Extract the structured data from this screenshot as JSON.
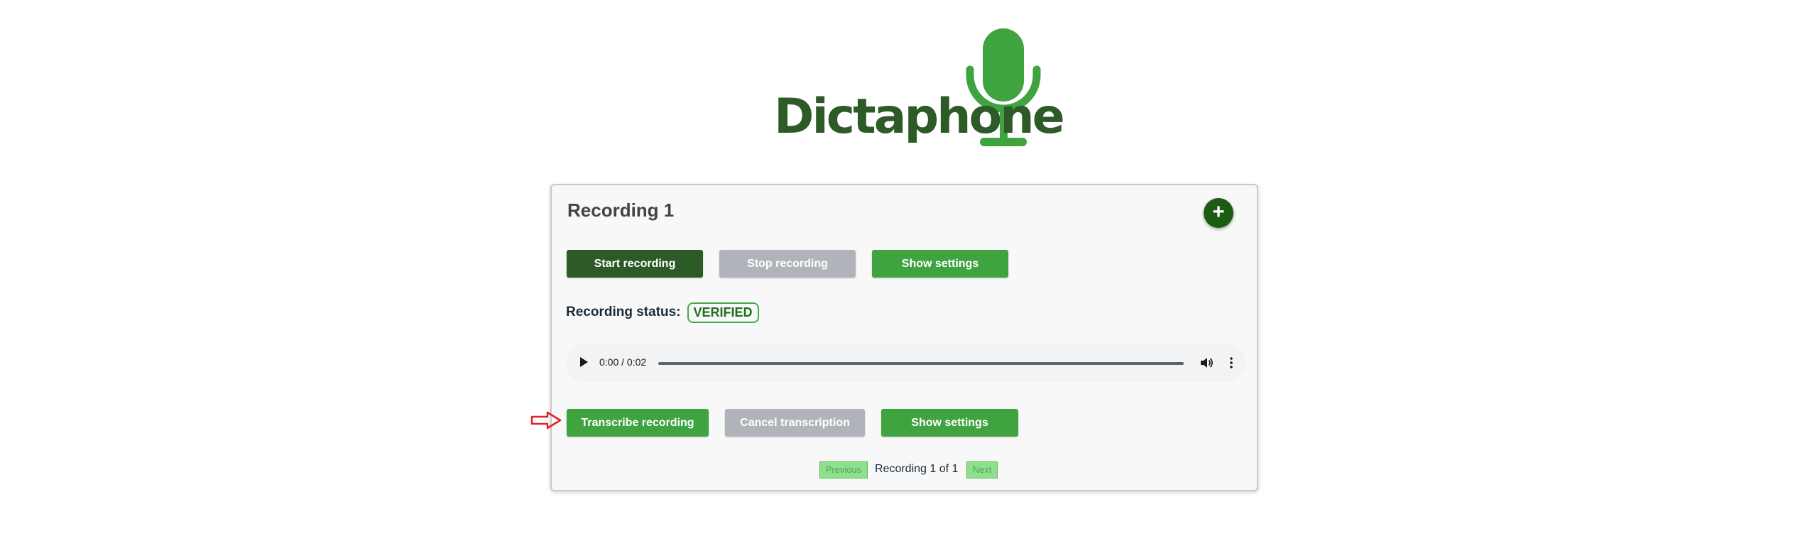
{
  "logo": {
    "text": "Dictaphone",
    "icon": "microphone-icon"
  },
  "card": {
    "title": "Recording 1",
    "add_label": "+",
    "recording_controls": {
      "start_label": "Start recording",
      "stop_label": "Stop recording",
      "settings_label": "Show settings"
    },
    "status": {
      "label": "Recording status:",
      "value": "VERIFIED"
    },
    "player": {
      "time": "0:00 / 0:02",
      "progress": 0
    },
    "transcription_controls": {
      "transcribe_label": "Transcribe recording",
      "cancel_label": "Cancel transcription",
      "settings_label": "Show settings"
    },
    "pagination": {
      "previous_label": "Previous",
      "text": "Recording 1 of 1",
      "next_label": "Next"
    }
  },
  "colors": {
    "brand_dark": "#2d5a27",
    "brand_green": "#3fa33f",
    "disabled_gray": "#b0b4ba",
    "add_button": "#1c5b12",
    "annotation_arrow": "#e0202a"
  }
}
